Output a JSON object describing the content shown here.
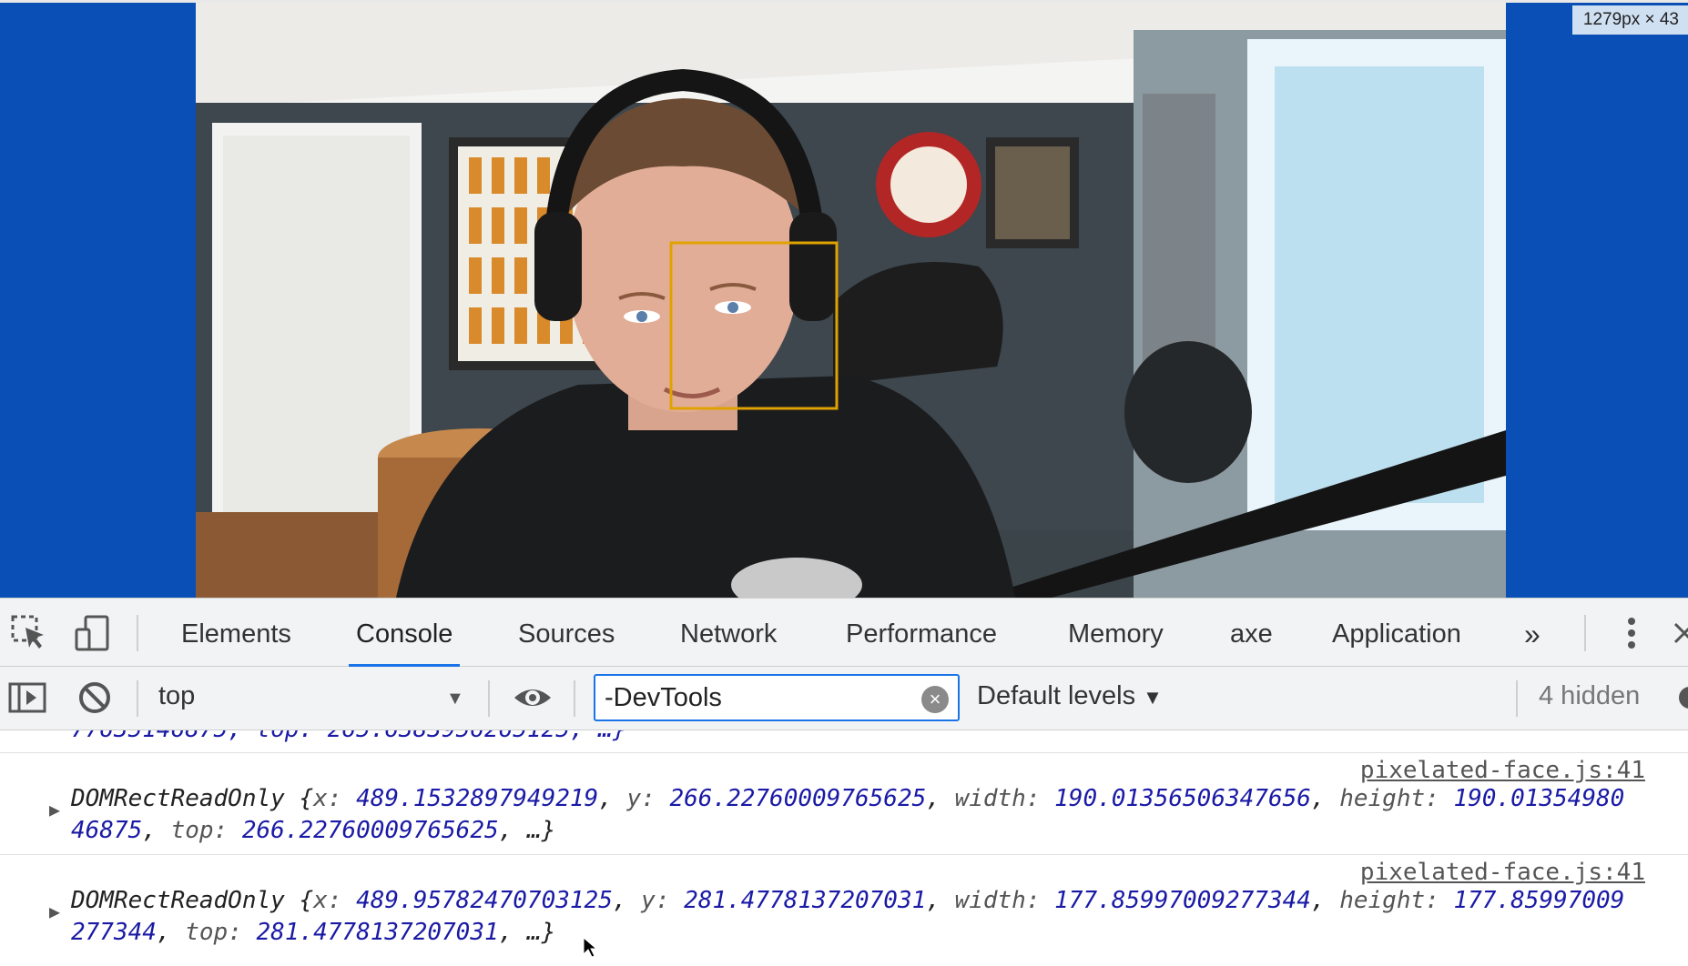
{
  "viewport": {
    "dimension_label": "1279px × 43",
    "background_color": "#0a4fb5",
    "face_box_color": "#e0a200"
  },
  "devtools": {
    "tabs": [
      {
        "label": "Elements"
      },
      {
        "label": "Console",
        "active": true
      },
      {
        "label": "Sources"
      },
      {
        "label": "Network"
      },
      {
        "label": "Performance"
      },
      {
        "label": "Memory"
      },
      {
        "label": "axe"
      },
      {
        "label": "Application"
      }
    ],
    "more_tabs_label": "»",
    "toolbar": {
      "context": "top",
      "filter_value": "-DevTools",
      "levels_label": "Default levels",
      "hidden_label": "4 hidden"
    },
    "console": {
      "cut_off_line": "77635146875, top: 265.6383956265125, …}",
      "entries": [
        {
          "source": "pixelated-face.js:41",
          "class_name": "DOMRectReadOnly",
          "x": "489.1532897949219",
          "y": "266.22760009765625",
          "width": "190.01356506347656",
          "height": "190.0135498046875",
          "top": "266.22760009765625"
        },
        {
          "source": "pixelated-face.js:41",
          "class_name": "DOMRectReadOnly",
          "x": "489.95782470703125",
          "y": "281.4778137207031",
          "width": "177.85997009277344",
          "height": "177.85997009277344",
          "top": "281.4778137207031"
        }
      ]
    }
  },
  "accent_color": "#1a73e8"
}
